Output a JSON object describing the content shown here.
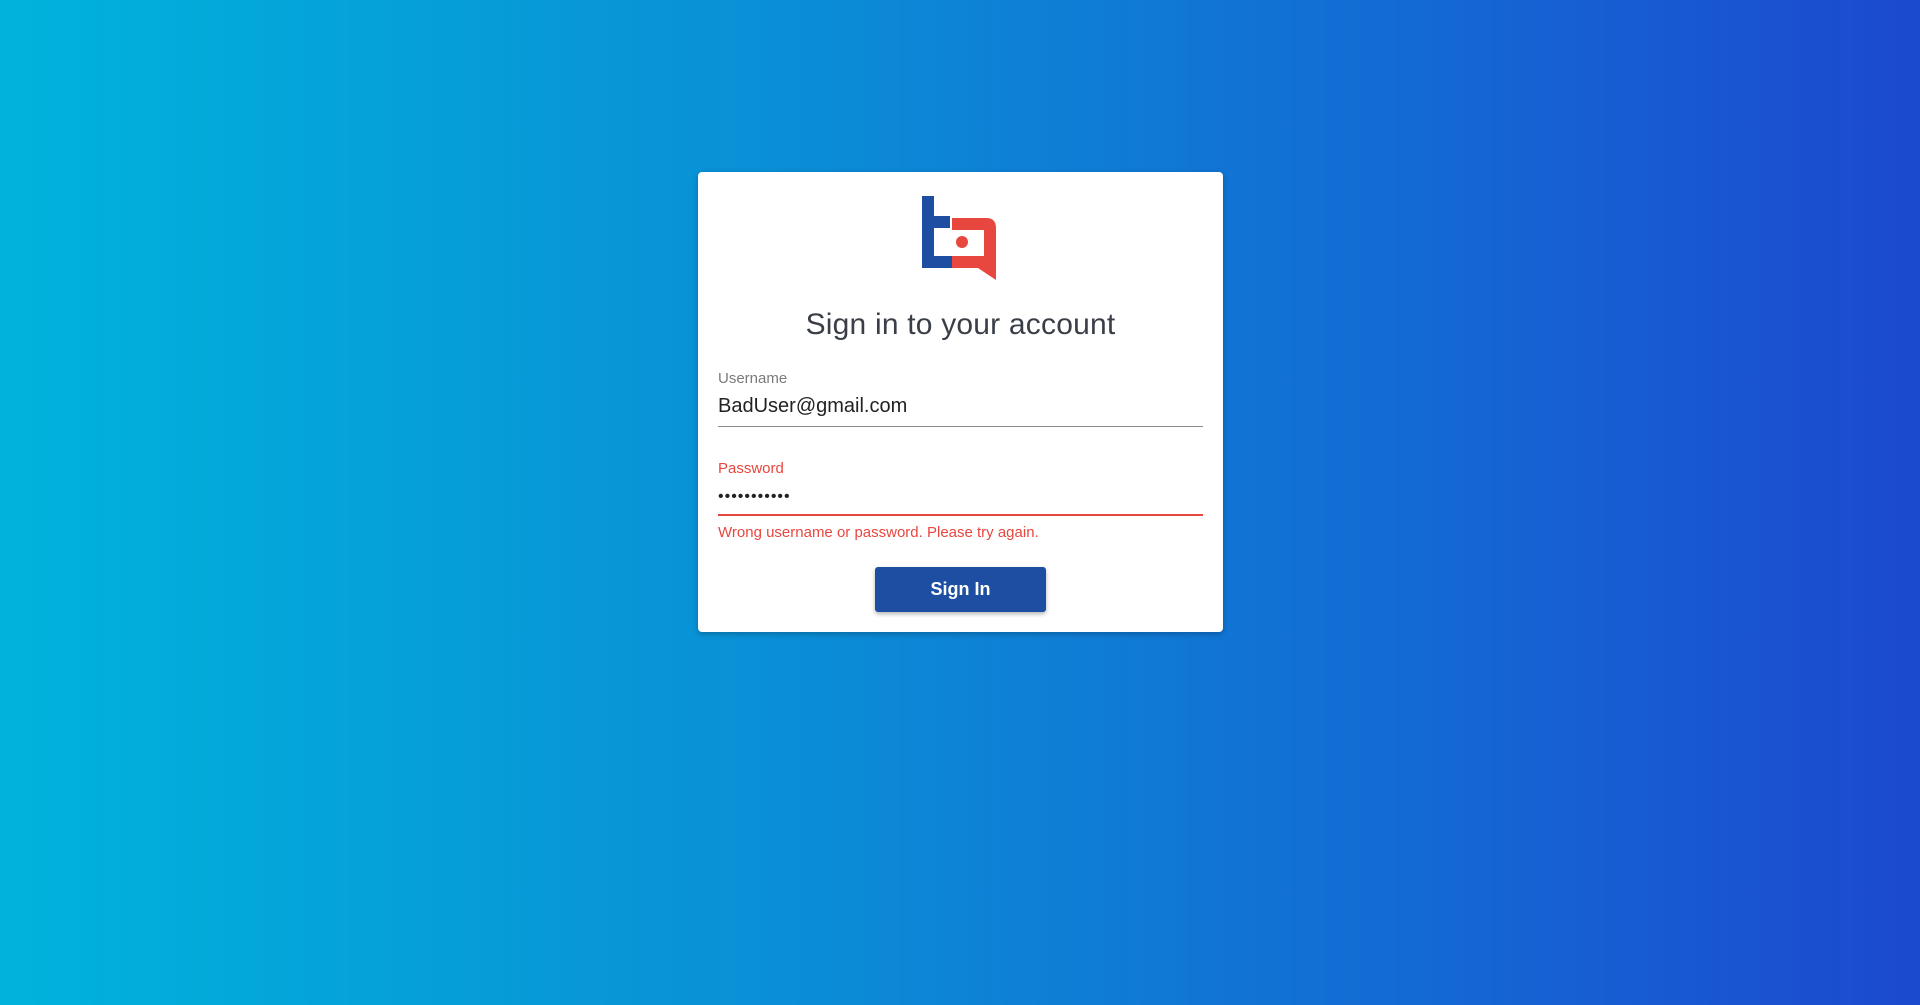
{
  "brand": {
    "logo_icon": "tq-logo-icon",
    "primary_color": "#1e4ea1",
    "accent_color": "#e8473f"
  },
  "login": {
    "title": "Sign in to your account",
    "username": {
      "label": "Username",
      "value": "BadUser@gmail.com"
    },
    "password": {
      "label": "Password",
      "value": "•••••••••••"
    },
    "error_message": "Wrong username or password. Please try again.",
    "submit_label": "Sign In"
  }
}
